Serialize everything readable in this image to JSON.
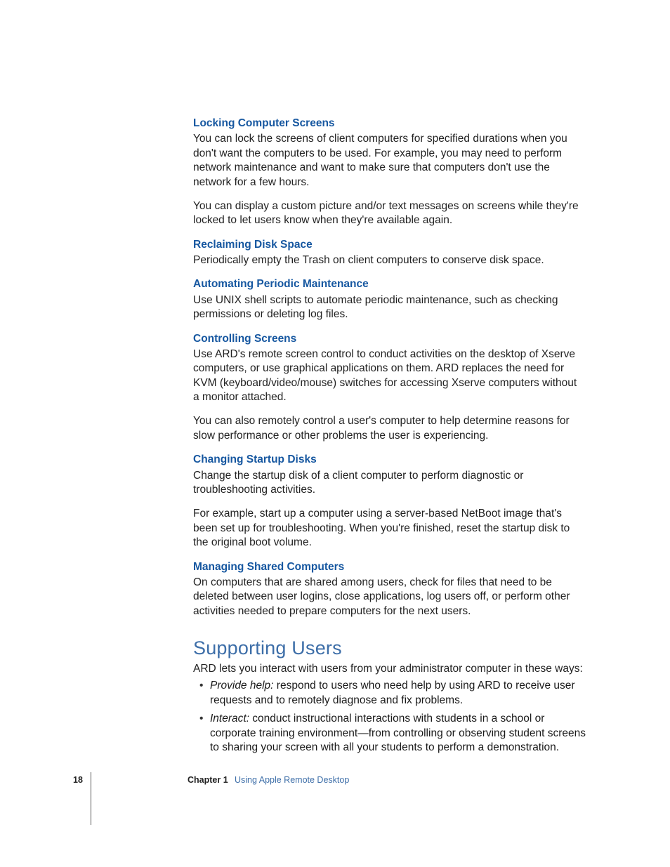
{
  "sections": [
    {
      "heading": "Locking Computer Screens",
      "paragraphs": [
        "You can lock the screens of client computers for specified durations when you don't want the computers to be used. For example, you may need to perform network maintenance and want to make sure that computers don't use the network for a few hours.",
        "You can display a custom picture and/or text messages on screens while they're locked to let users know when they're available again."
      ]
    },
    {
      "heading": "Reclaiming Disk Space",
      "paragraphs": [
        "Periodically empty the Trash on client computers to conserve disk space."
      ]
    },
    {
      "heading": "Automating Periodic Maintenance",
      "paragraphs": [
        "Use UNIX shell scripts to automate periodic maintenance, such as checking permissions or deleting log files."
      ]
    },
    {
      "heading": "Controlling Screens",
      "paragraphs": [
        "Use ARD's remote screen control to conduct activities on the desktop of Xserve computers, or use graphical applications on them. ARD replaces the need for KVM (keyboard/video/mouse) switches for accessing Xserve computers without a monitor attached.",
        "You can also remotely control a user's computer to help determine reasons for slow performance or other problems the user is experiencing."
      ]
    },
    {
      "heading": "Changing Startup Disks",
      "paragraphs": [
        "Change the startup disk of a client computer to perform diagnostic or troubleshooting activities.",
        "For example, start up a computer using a server-based NetBoot image that's been set up for troubleshooting. When you're finished, reset the startup disk to the original boot volume."
      ]
    },
    {
      "heading": "Managing Shared Computers",
      "paragraphs": [
        "On computers that are shared among users, check for files that need to be deleted between user logins, close applications, log users off, or perform other activities needed to prepare computers for the next users."
      ]
    }
  ],
  "major_section": {
    "title": "Supporting Users",
    "intro": "ARD lets you interact with users from your administrator computer in these ways:",
    "bullets": [
      {
        "term": "Provide help:",
        "text": "  respond to users who need help by using ARD to receive user requests and to remotely diagnose and fix problems."
      },
      {
        "term": "Interact:",
        "text": "  conduct instructional interactions with students in a school or corporate training environment—from controlling or observing student screens to sharing your screen with all your students to perform a demonstration."
      }
    ]
  },
  "footer": {
    "page_number": "18",
    "chapter_label": "Chapter 1",
    "chapter_title": "Using Apple Remote Desktop"
  }
}
